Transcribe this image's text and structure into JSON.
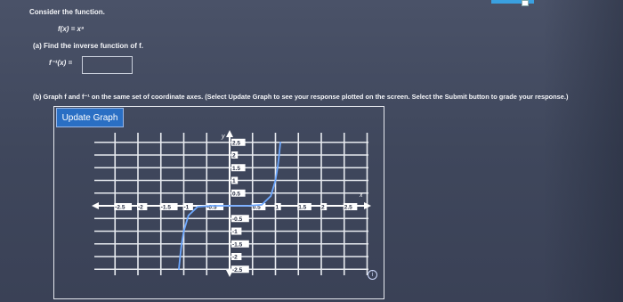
{
  "problem": {
    "instruction": "Consider the function.",
    "function_text": "f(x) = x⁹"
  },
  "part_a": {
    "label": "(a)  Find the inverse function of f.",
    "inverse_label": "f⁻¹(x) =",
    "answer_value": ""
  },
  "part_b": {
    "label": "(b)  Graph f and f⁻¹ on the same set of coordinate axes. (Select Update Graph to see your response plotted on the screen. Select the Submit button to grade your response.)",
    "update_button_label": "Update Graph"
  },
  "graph": {
    "x_axis_letter": "x",
    "y_axis_letter": "y",
    "x_tick_labels": [
      "-2.5",
      "-2",
      "-1.5",
      "-1",
      "-0.5",
      "0.5",
      "1",
      "1.5",
      "2",
      "2.5"
    ],
    "y_tick_labels_positive": [
      "2.5",
      "2",
      "1.5",
      "1",
      "0.5"
    ],
    "y_tick_labels_negative": [
      "-0.5",
      "-1",
      "-1.5",
      "-2",
      "-2.5"
    ],
    "curve_color": "#6ea8ff",
    "grid_color": "#e8ebf0"
  },
  "chart_data": {
    "type": "line",
    "title": "",
    "xlabel": "x",
    "ylabel": "y",
    "xlim": [
      -3,
      3
    ],
    "ylim": [
      -3,
      3
    ],
    "grid": true,
    "series": [
      {
        "x": [
          -1.108,
          -1.08,
          -1.05,
          -1.0,
          -0.9,
          -0.7,
          -0.4,
          0,
          0.4,
          0.7,
          0.9,
          1.0,
          1.05,
          1.08,
          1.108
        ],
        "y": [
          -2.52,
          -2.0,
          -1.55,
          -1.0,
          -0.387,
          -0.04,
          -0.00026,
          0,
          0.00026,
          0.04,
          0.387,
          1.0,
          1.55,
          2.0,
          2.52
        ]
      }
    ]
  },
  "icons": {
    "info": "info-icon"
  }
}
